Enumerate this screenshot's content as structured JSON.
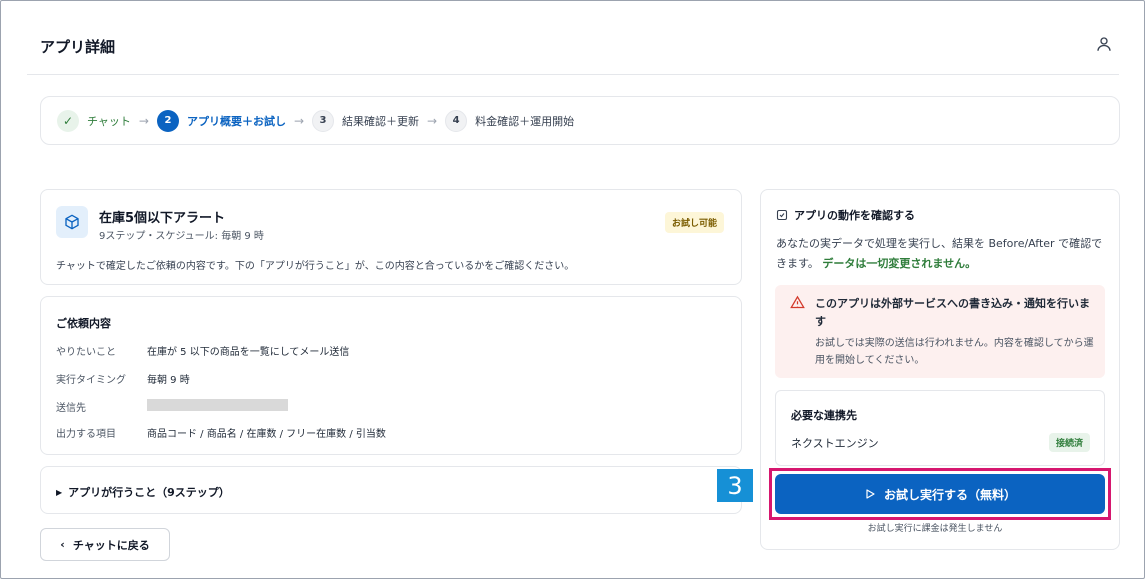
{
  "header": {
    "title": "アプリ詳細",
    "user_icon": "user-icon"
  },
  "stepper": {
    "steps": [
      {
        "num": "✓",
        "label": "チャット",
        "state": "done"
      },
      {
        "num": "2",
        "label": "アプリ概要＋お試し",
        "state": "active"
      },
      {
        "num": "3",
        "label": "結果確認＋更新",
        "state": "todo"
      },
      {
        "num": "4",
        "label": "料金確認＋運用開始",
        "state": "todo"
      }
    ],
    "arrow": "→"
  },
  "app": {
    "name": "在庫5個以下アラート",
    "subtitle": "9ステップ・スケジュール: 毎朝 9 時",
    "badge": "お試し可能",
    "description": "チャットで確定したご依頼の内容です。下の「アプリが行うこと」が、この内容と合っているかをご確認ください。"
  },
  "request": {
    "title": "ご依頼内容",
    "rows": [
      {
        "key": "やりたいこと",
        "value": "在庫が 5 以下の商品を一覧にしてメール送信"
      },
      {
        "key": "実行タイミング",
        "value": "毎朝 9 時"
      },
      {
        "key": "送信先",
        "value": ""
      },
      {
        "key": "出力する項目",
        "value": "商品コード / 商品名 / 在庫数 / フリー在庫数 / 引当数"
      }
    ]
  },
  "steps_section": {
    "label": "アプリが行うこと（9ステップ）"
  },
  "back_button": {
    "label": "チャットに戻る"
  },
  "side": {
    "title": "アプリの動作を確認する",
    "desc_main": "あなたの実データで処理を実行し、結果を Before/After で確認できます。",
    "desc_emphasis": "データは一切変更されません。",
    "warning": {
      "title": "このアプリは外部サービスへの書き込み・通知を行います",
      "body": "お試しでは実際の送信は行われません。内容を確認してから運用を開始してください。"
    },
    "integration": {
      "title": "必要な連携先",
      "name": "ネクストエンジン",
      "status": "接続済"
    },
    "run_button": "お試し実行する（無料）",
    "run_note": "お試し実行に課金は発生しません",
    "marker": "3"
  },
  "colors": {
    "primary": "#0b63c1",
    "success": "#2f7d3b",
    "highlight": "#d6176f",
    "marker": "#1690d6"
  }
}
